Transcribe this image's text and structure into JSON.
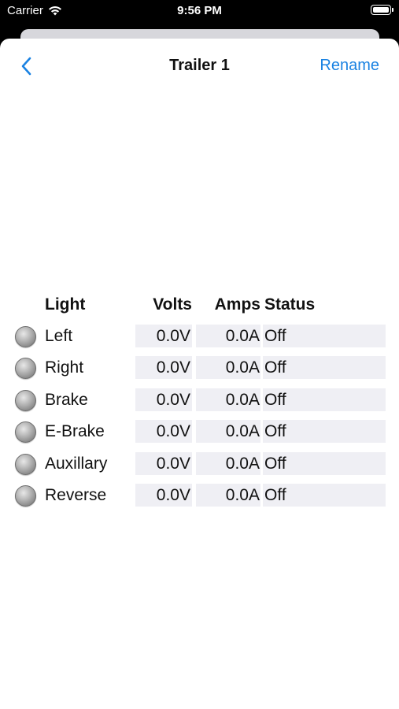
{
  "status_bar": {
    "carrier": "Carrier",
    "time": "9:56 PM"
  },
  "nav": {
    "title": "Trailer 1",
    "rename_label": "Rename"
  },
  "table": {
    "headers": {
      "light": "Light",
      "volts": "Volts",
      "amps": "Amps",
      "status": "Status"
    },
    "rows": [
      {
        "light": "Left",
        "volts": "0.0V",
        "amps": "0.0A",
        "status": "Off"
      },
      {
        "light": "Right",
        "volts": "0.0V",
        "amps": "0.0A",
        "status": "Off"
      },
      {
        "light": "Brake",
        "volts": "0.0V",
        "amps": "0.0A",
        "status": "Off"
      },
      {
        "light": "E-Brake",
        "volts": "0.0V",
        "amps": "0.0A",
        "status": "Off"
      },
      {
        "light": "Auxillary",
        "volts": "0.0V",
        "amps": "0.0A",
        "status": "Off"
      },
      {
        "light": "Reverse",
        "volts": "0.0V",
        "amps": "0.0A",
        "status": "Off"
      }
    ]
  },
  "colors": {
    "accent": "#1a82e2",
    "cell_background": "#efeff4",
    "indicator_off": "#9a9a9a"
  },
  "icons": {
    "back": "chevron-left-icon",
    "wifi": "wifi-icon",
    "battery": "battery-icon",
    "indicator": "indicator-light-icon"
  }
}
